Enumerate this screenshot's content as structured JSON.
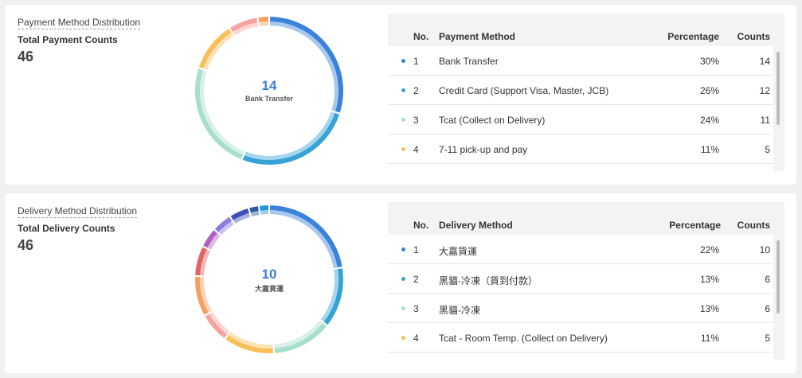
{
  "payment": {
    "title": "Payment Method Distribution",
    "total_label": "Total Payment Counts",
    "total_value": "46",
    "center_value": "14",
    "center_label": "Bank Transfer",
    "headers": {
      "no": "No.",
      "name": "Payment Method",
      "pct": "Percentage",
      "count": "Counts"
    },
    "rows": [
      {
        "no": "1",
        "name": "Bank Transfer",
        "pct": "30%",
        "count": "14",
        "color": "#3b82db"
      },
      {
        "no": "2",
        "name": "Credit Card (Support Visa, Master, JCB)",
        "pct": "26%",
        "count": "12",
        "color": "#35a3d6"
      },
      {
        "no": "3",
        "name": "Tcat (Collect on Delivery)",
        "pct": "24%",
        "count": "11",
        "color": "#a8dfcc"
      },
      {
        "no": "4",
        "name": "7-11 pick-up and pay",
        "pct": "11%",
        "count": "5",
        "color": "#fbbf5a"
      }
    ],
    "segments": [
      {
        "value": 30,
        "color": "#3b82db"
      },
      {
        "value": 26,
        "color": "#35a3d6"
      },
      {
        "value": 24,
        "color": "#a8dfcc"
      },
      {
        "value": 11,
        "color": "#fbbf5a"
      },
      {
        "value": 6.5,
        "color": "#f7a3a0"
      },
      {
        "value": 2.5,
        "color": "#f5a05f"
      }
    ]
  },
  "delivery": {
    "title": "Delivery Method Distribution",
    "total_label": "Total Delivery Counts",
    "total_value": "46",
    "center_value": "10",
    "center_label": "大嘉貨運",
    "headers": {
      "no": "No.",
      "name": "Delivery Method",
      "pct": "Percentage",
      "count": "Counts"
    },
    "rows": [
      {
        "no": "1",
        "name": "大嘉貨運",
        "pct": "22%",
        "count": "10",
        "color": "#3b82db"
      },
      {
        "no": "2",
        "name": "黑貓-冷凍（貨到付款）",
        "pct": "13%",
        "count": "6",
        "color": "#35a3d6"
      },
      {
        "no": "3",
        "name": "黑貓-冷凍",
        "pct": "13%",
        "count": "6",
        "color": "#a8dfcc"
      },
      {
        "no": "4",
        "name": "Tcat - Room Temp. (Collect on Delivery)",
        "pct": "11%",
        "count": "5",
        "color": "#fbbf5a"
      }
    ],
    "segments": [
      {
        "value": 22,
        "color": "#3b82db"
      },
      {
        "value": 13,
        "color": "#35a3d6"
      },
      {
        "value": 13,
        "color": "#a8dfcc"
      },
      {
        "value": 11,
        "color": "#fbbf5a"
      },
      {
        "value": 6.5,
        "color": "#f7a3a0"
      },
      {
        "value": 8.7,
        "color": "#f5a05f"
      },
      {
        "value": 6.5,
        "color": "#e06666"
      },
      {
        "value": 4.3,
        "color": "#b05fc0"
      },
      {
        "value": 4.3,
        "color": "#8e7be0"
      },
      {
        "value": 4.3,
        "color": "#3d4fb8"
      },
      {
        "value": 2.2,
        "color": "#2a5c9e"
      },
      {
        "value": 2.2,
        "color": "#2196e0"
      }
    ]
  }
}
